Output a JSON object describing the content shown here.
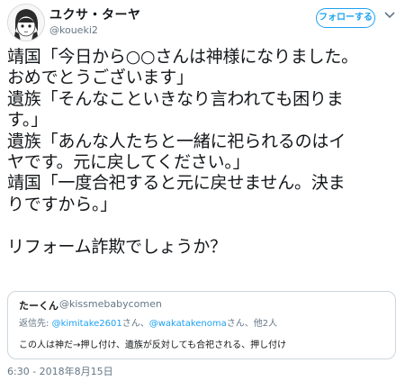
{
  "tweet": {
    "display_name": "ユクサ・ターヤ",
    "handle": "@koueki2",
    "follow_label": "フォローする",
    "text_lines": [
      "靖国「今日から○○さんは神様になりました。",
      "おめでとうございます」",
      "遺族「そんなこといきなり言われても困りま",
      "す。」",
      "遺族「あんな人たちと一緒に祀られるのはイ",
      "ヤです。元に戻してください。」",
      "靖国「一度合祀すると元に戻せません。決ま",
      "りですから。」",
      "",
      "リフォーム詐欺でしょうか？"
    ],
    "timestamp": "6:30 - 2018年8月15日"
  },
  "quote": {
    "display_name": "たーくん",
    "handle": "@kissmebabycomen",
    "reply_prefix": "返信先: ",
    "reply_user1": "@kimitake2601",
    "reply_sep1": "さん、",
    "reply_user2": "@wakatakenoma",
    "reply_sep2": "さん、他2人",
    "text": "この人は神だ→押し付け、遺族が反対しても合祀される、押し付け"
  }
}
